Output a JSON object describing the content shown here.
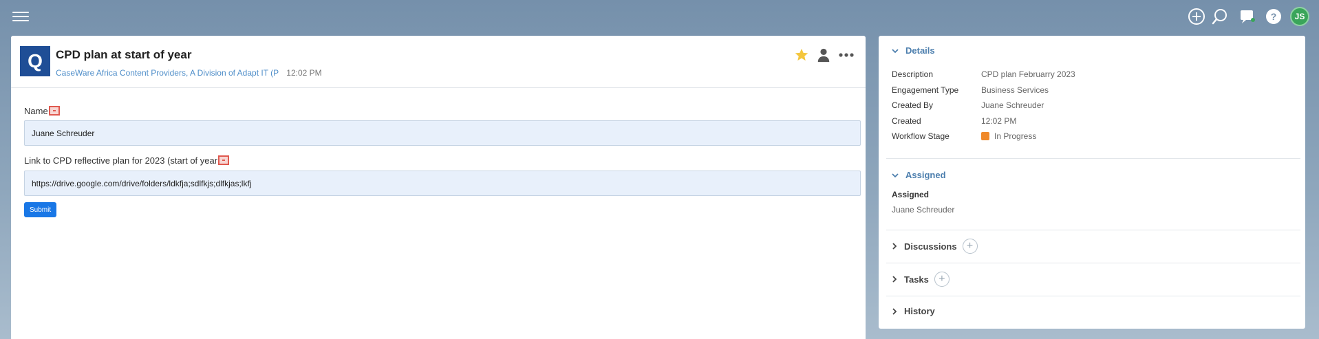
{
  "topbar": {
    "icons": [
      "add-icon",
      "search-icon",
      "chat-icon",
      "help-icon"
    ],
    "avatar_initials": "JS"
  },
  "card": {
    "badge_letter": "Q",
    "title": "CPD plan at start of year",
    "organization": "CaseWare Africa Content Providers, A Division of Adapt IT (P",
    "time": "12:02 PM"
  },
  "form": {
    "fields": [
      {
        "label": "Name",
        "value": "Juane Schreuder"
      },
      {
        "label": "Link to CPD reflective plan for 2023 (start of year",
        "value": "https://drive.google.com/drive/folders/ldkfja;sdlfkjs;dlfkjas;lkfj"
      }
    ],
    "submit_label": "Submit"
  },
  "details": {
    "heading": "Details",
    "rows": [
      {
        "key": "Description",
        "value": "CPD plan Februarry 2023"
      },
      {
        "key": "Engagement Type",
        "value": "Business Services"
      },
      {
        "key": "Created By",
        "value": "Juane Schreuder"
      },
      {
        "key": "Created",
        "value": "12:02 PM"
      },
      {
        "key": "Workflow Stage",
        "value": "In Progress"
      }
    ],
    "stage_color": "#f0892a"
  },
  "assigned": {
    "heading": "Assigned",
    "label": "Assigned",
    "value": "Juane Schreuder"
  },
  "sections": {
    "discussions": "Discussions",
    "tasks": "Tasks",
    "history": "History"
  },
  "colors": {
    "accent": "#1977e6",
    "badge": "#1f4e96",
    "link": "#4f8ec9",
    "star": "#f4c63d",
    "avatar": "#3aa55a"
  }
}
